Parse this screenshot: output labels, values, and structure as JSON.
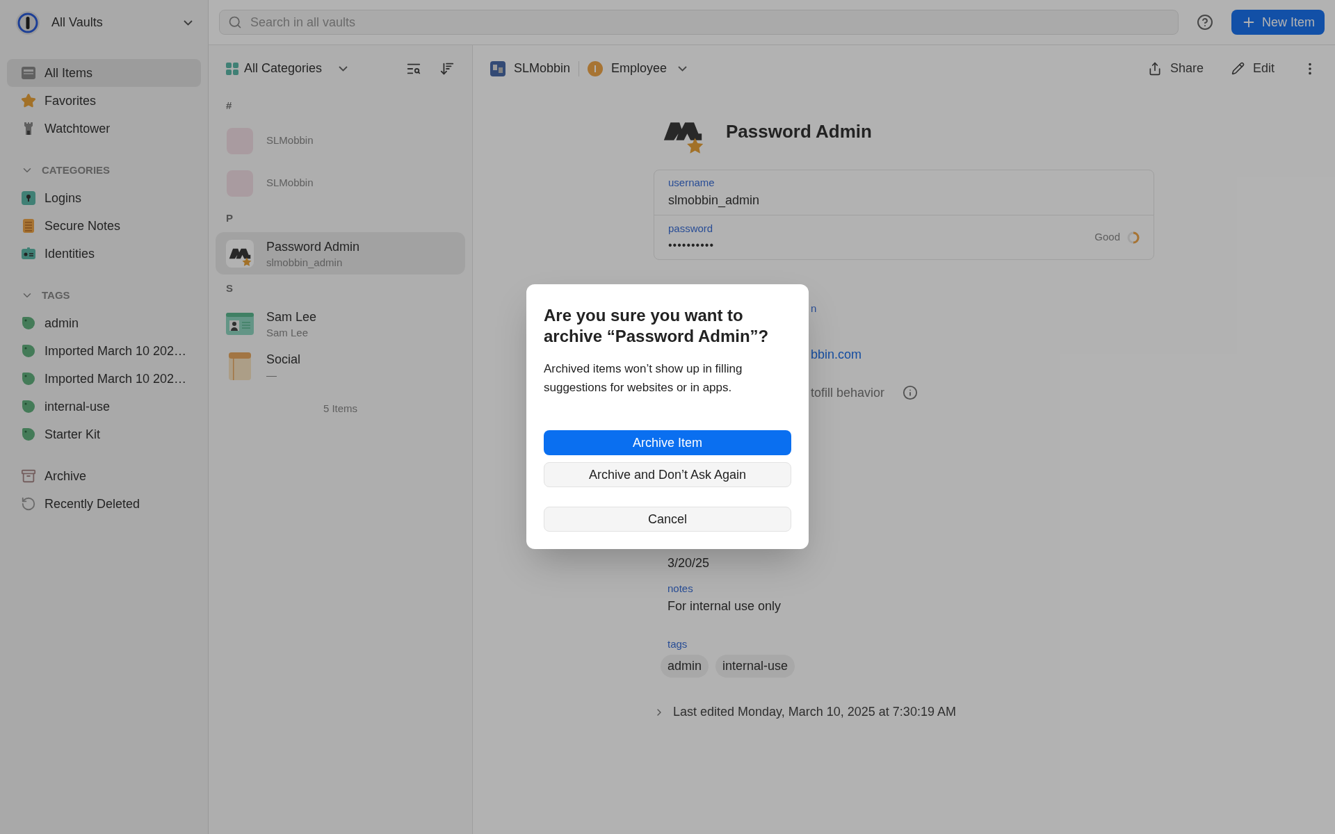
{
  "vault_selector": {
    "label": "All Vaults"
  },
  "search": {
    "placeholder": "Search in all vaults"
  },
  "new_item_button": {
    "label": "New Item"
  },
  "sidebar": {
    "main_items": [
      {
        "label": "All Items",
        "kind": "all",
        "selected": true
      },
      {
        "label": "Favorites",
        "kind": "favorites",
        "selected": false
      },
      {
        "label": "Watchtower",
        "kind": "watchtower",
        "selected": false
      }
    ],
    "sections": [
      {
        "title": "CATEGORIES",
        "expanded": true,
        "items": [
          {
            "label": "Logins",
            "kind": "login",
            "selected": false
          },
          {
            "label": "Secure Notes",
            "kind": "note",
            "selected": false
          },
          {
            "label": "Identities",
            "kind": "identity",
            "selected": false
          }
        ]
      },
      {
        "title": "TAGS",
        "expanded": true,
        "items": [
          {
            "label": "admin",
            "kind": "tag",
            "selected": false
          },
          {
            "label": "Imported March 10 202…",
            "kind": "tag",
            "selected": false
          },
          {
            "label": "Imported March 10 202…",
            "kind": "tag",
            "selected": false
          },
          {
            "label": "internal-use",
            "kind": "tag",
            "selected": false
          },
          {
            "label": "Starter Kit",
            "kind": "tag",
            "selected": false
          }
        ]
      }
    ],
    "bottom_items": [
      {
        "label": "Archive",
        "kind": "archive",
        "selected": false
      },
      {
        "label": "Recently Deleted",
        "kind": "deleted",
        "selected": false
      }
    ]
  },
  "item_list": {
    "filter": "All Categories",
    "groups": [
      {
        "letter": "#",
        "items": [
          {
            "title": "SLMobbin",
            "kind": "blank",
            "selected": false
          },
          {
            "title": "SLMobbin",
            "kind": "blank",
            "selected": false
          }
        ]
      },
      {
        "letter": "P",
        "items": [
          {
            "title": "Password Admin",
            "subtitle": "slmobbin_admin",
            "kind": "logo",
            "favorite": true,
            "selected": true
          }
        ]
      },
      {
        "letter": "S",
        "items": [
          {
            "title": "Sam Lee",
            "subtitle": "Sam Lee",
            "kind": "identity",
            "selected": false
          },
          {
            "title": "Social",
            "subtitle": "—",
            "kind": "note",
            "selected": false
          }
        ]
      }
    ],
    "count": "5 Items"
  },
  "detail": {
    "vault": "SLMobbin",
    "category": "Employee",
    "actions": [
      {
        "label": "Share",
        "kind": "share"
      },
      {
        "label": "Edit",
        "kind": "edit"
      }
    ],
    "title": "Password Admin",
    "favorite": true,
    "fields": [
      {
        "label": "username",
        "value": "slmobbin_admin",
        "kind": "text"
      },
      {
        "label": "password",
        "value": "••••••••••",
        "kind": "password",
        "strength": "Good"
      }
    ],
    "partly_hidden": [
      {
        "kind": "label",
        "text": "n"
      },
      {
        "kind": "link",
        "text": "bbin.com"
      },
      {
        "kind": "setting",
        "text": "tofill behavior"
      },
      {
        "kind": "value",
        "text": "3/20/25"
      }
    ],
    "notes": {
      "label": "notes",
      "value": "For internal use only"
    },
    "tags": {
      "label": "tags",
      "values": [
        "admin",
        "internal-use"
      ]
    },
    "last_edited": "Last edited Monday, March 10, 2025 at 7:30:19 AM"
  },
  "dialog": {
    "title": "Are you sure you want to archive “Password Admin”?",
    "message": "Archived items won’t show up in filling suggestions for websites or in apps.",
    "buttons": [
      {
        "label": "Archive Item",
        "kind": "primary"
      },
      {
        "label": "Archive and Don’t Ask Again",
        "kind": "secondary"
      },
      {
        "label": "Cancel",
        "kind": "cancel"
      }
    ]
  }
}
